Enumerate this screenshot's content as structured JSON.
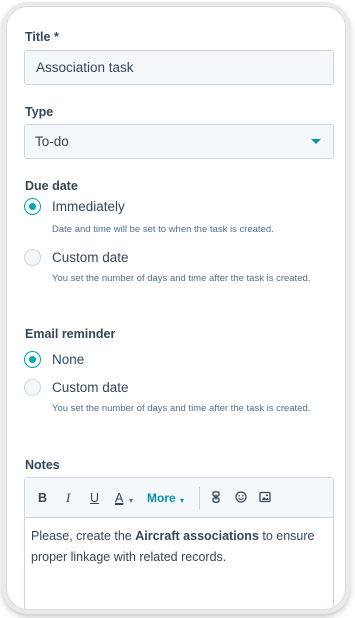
{
  "title_field": {
    "label": "Title *",
    "value": "Association task"
  },
  "type_field": {
    "label": "Type",
    "selected": "To-do"
  },
  "due_date": {
    "label": "Due date",
    "options": [
      {
        "label": "Immediately",
        "checked": true,
        "help": "Date and time will be set to when the task is created."
      },
      {
        "label": "Custom date",
        "checked": false,
        "help": "You set the number of days and time after the task is created."
      }
    ]
  },
  "email_reminder": {
    "label": "Email reminder",
    "options": [
      {
        "label": "None",
        "checked": true
      },
      {
        "label": "Custom date",
        "checked": false,
        "help": "You set the number of days and time after the task is created."
      }
    ]
  },
  "notes": {
    "label": "Notes",
    "toolbar": {
      "bold": "B",
      "italic": "I",
      "underline": "U",
      "font_color": "A",
      "more": "More",
      "icons": [
        "link-icon",
        "emoji-icon",
        "image-icon"
      ]
    },
    "content": {
      "before": "Please, create the ",
      "bold": "Aircraft associations",
      "after": " to ensure proper linkage with related records."
    }
  },
  "colors": {
    "accent": "#00a4bd",
    "link": "#0091ae",
    "text": "#33475b",
    "field_bg": "#f5f8fa",
    "border": "#cbd6e2"
  }
}
